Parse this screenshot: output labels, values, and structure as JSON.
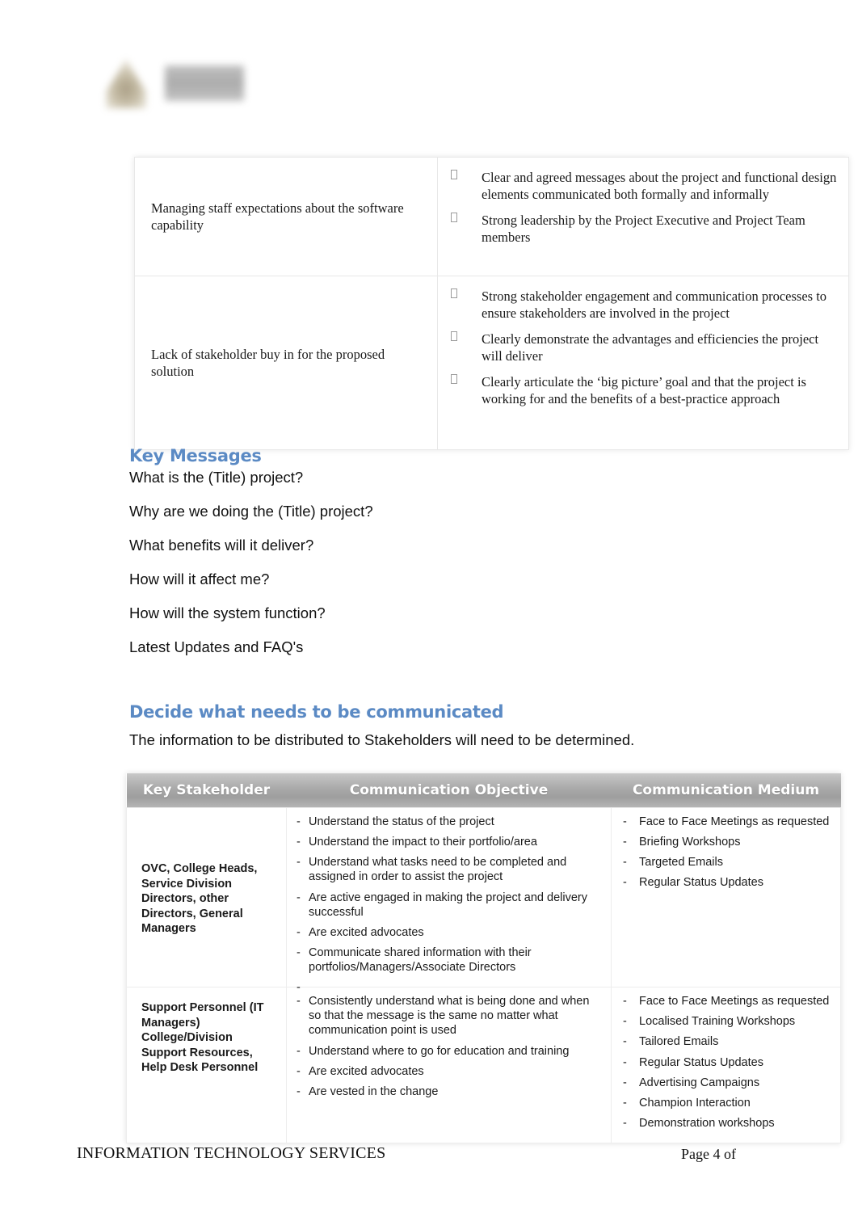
{
  "document": {
    "logo": {
      "crest_icon": "university-crest-icon",
      "wordmark_icon": "university-wordmark-icon"
    }
  },
  "risk_table": {
    "rows": [
      {
        "risk": "Managing staff expectations about the software capability",
        "controls": [
          "Clear and agreed messages about the project and functional design elements communicated both formally and informally",
          "Strong leadership by the Project Executive and Project Team members"
        ]
      },
      {
        "risk": "Lack of stakeholder buy in for the proposed solution",
        "controls": [
          "Strong stakeholder engagement and communication processes to ensure stakeholders are involved in the project",
          "Clearly demonstrate the advantages and efficiencies the project will deliver",
          "Clearly articulate the ‘big picture’ goal and that the project is working for and the benefits of a best-practice approach"
        ]
      }
    ]
  },
  "key_messages": {
    "heading": "Key Messages",
    "items": [
      "What is the (Title) project?",
      "Why are we doing the (Title) project?",
      "What benefits will it deliver?",
      "How will it affect me?",
      "How will the system function?",
      "Latest Updates and FAQ's"
    ]
  },
  "decide_section": {
    "heading": "Decide what needs to be communicated",
    "intro": "The information to be distributed to Stakeholders will need to be determined."
  },
  "stakeholder_table": {
    "headers": {
      "stakeholder": "Key Stakeholder",
      "objective": "Communication Objective",
      "medium": "Communication Medium"
    },
    "rows": [
      {
        "stakeholder": "OVC, College Heads, Service Division Directors, other Directors, General Managers",
        "objectives": [
          "Understand the status of the project",
          "Understand the impact to their portfolio/area",
          "Understand what tasks need to be completed and assigned in order to assist the project",
          "Are active engaged in making the project and delivery successful",
          "Are excited advocates",
          "Communicate shared information with their portfolios/Managers/Associate Directors",
          ""
        ],
        "mediums": [
          "Face to Face Meetings as requested",
          "Briefing Workshops",
          "Targeted Emails",
          "Regular Status Updates"
        ]
      },
      {
        "stakeholder": "Support Personnel (IT Managers) College/Division Support Resources, Help Desk Personnel",
        "objectives": [
          "Consistently understand what is being done and when so that the message is the same no matter what communication point is used",
          "Understand where to go for education and training",
          "Are excited advocates",
          "Are vested in the change"
        ],
        "mediums": [
          "Face to Face Meetings as requested",
          "Localised Training Workshops",
          "Tailored Emails",
          "Regular Status Updates",
          "Advertising Campaigns",
          "Champion Interaction",
          "Demonstration workshops"
        ]
      }
    ]
  },
  "footer": {
    "left": "INFORMATION TECHNOLOGY SERVICES",
    "right": "Page 4 of"
  },
  "colors": {
    "heading_blue": "#5b8ac4",
    "table_header_gray": "#a9a9a9",
    "body_text": "#111111"
  }
}
